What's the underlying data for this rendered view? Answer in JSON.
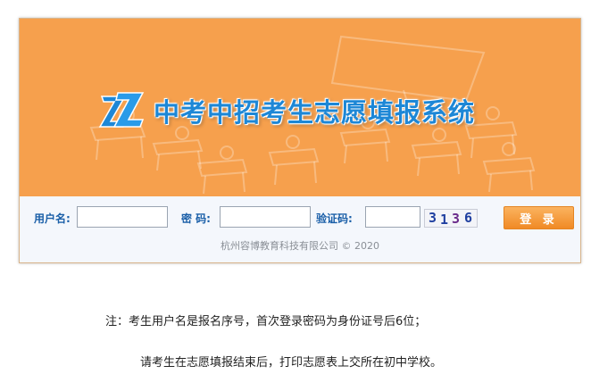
{
  "banner": {
    "title": "中考中招考生志愿填报系统",
    "logo_icon": "zz-logo-icon",
    "background_color": "#f6a04d",
    "title_color": "#1d87d6"
  },
  "login_form": {
    "username_label": "用户名:",
    "username_value": "",
    "password_label": "密 码:",
    "password_value": "",
    "captcha_label": "验证码:",
    "captcha_value": "",
    "captcha_chars": [
      "3",
      "1",
      "3",
      "6"
    ],
    "captcha_colors": [
      "#1f3fa0",
      "#1f3fa0",
      "#6a2a8a",
      "#1f3fa0"
    ],
    "login_button": "登 录",
    "accent_color": "#f08a25"
  },
  "copyright": "杭州容博教育科技有限公司 © 2020",
  "notes": {
    "line1": "注：考生用户名是报名序号，首次登录密码为身份证号后6位；",
    "line2": "请考生在志愿填报结束后，打印志愿表上交所在初中学校。"
  }
}
